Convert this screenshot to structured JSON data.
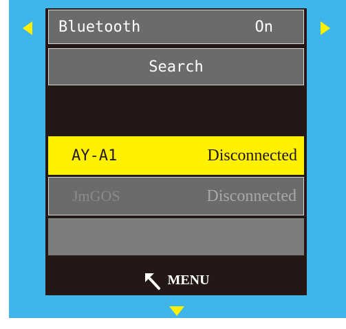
{
  "bluetooth": {
    "label": "Bluetooth",
    "status": "On"
  },
  "search": {
    "label": "Search"
  },
  "devices": [
    {
      "name": "AY-A1",
      "status": "Disconnected",
      "selected": true
    },
    {
      "name": "JmGOS",
      "status": "Disconnected",
      "selected": false
    }
  ],
  "footer": {
    "menu_label": "MENU",
    "icon": "back-arrow-icon"
  },
  "colors": {
    "background": "#3fb5ea",
    "screen": "#231815",
    "highlight": "#fff100",
    "row": "#6b6b6b"
  }
}
